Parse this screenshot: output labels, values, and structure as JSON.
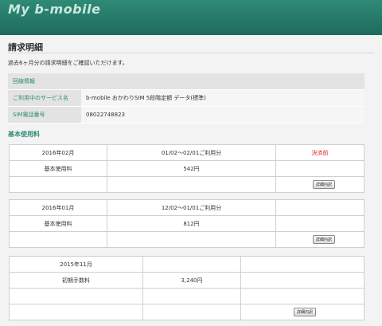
{
  "header": {
    "logo": "My b-mobile"
  },
  "page": {
    "title": "請求明細",
    "intro": "過去6ヶ月分の請求明細をご確認いただけます。"
  },
  "line_info": {
    "heading": "回線情報",
    "rows": [
      {
        "label": "ご利用中のサービス名",
        "value": "b-mobile おかわりSIM 5段階定額 データ(標準)"
      },
      {
        "label": "SIM電話番号",
        "value": "08022748823"
      }
    ]
  },
  "basic_usage": {
    "title": "基本使用料",
    "bills": [
      {
        "month": "2016年02月",
        "period": "01/02～02/01ご利用分",
        "status": "決済前",
        "fee_label": "基本使用料",
        "fee": "542円",
        "detail": "詳細内訳"
      },
      {
        "month": "2016年01月",
        "period": "12/02～01/01ご利用分",
        "status": "",
        "fee_label": "基本使用料",
        "fee": "812円",
        "detail": "詳細内訳"
      }
    ],
    "initial": {
      "month": "2015年11月",
      "fee_label": "初期手数料",
      "fee": "3,240円",
      "detail": "詳細内訳"
    }
  },
  "colors": {
    "accent": "#2f8a76",
    "status_red": "#e0201e"
  }
}
